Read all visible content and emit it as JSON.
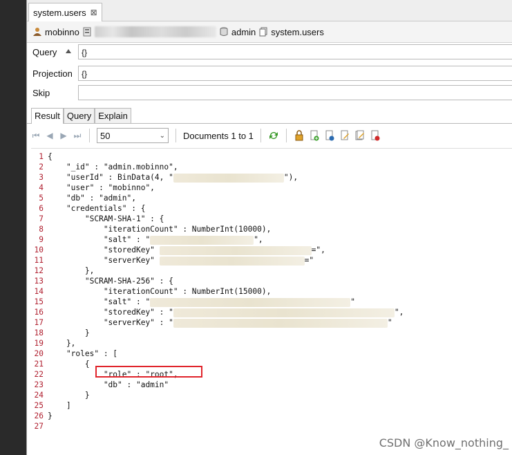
{
  "tab": {
    "title": "system.users",
    "close": "⊠"
  },
  "connection": {
    "user": "mobinno",
    "db": "admin",
    "collection": "system.users"
  },
  "query": {
    "label": "Query",
    "value": "{}"
  },
  "projection": {
    "label": "Projection",
    "value": "{}"
  },
  "skip": {
    "label": "Skip",
    "value": ""
  },
  "result_tabs": [
    "Result",
    "Query",
    "Explain"
  ],
  "toolbar": {
    "page_size": "50",
    "documents_label": "Documents 1 to 1"
  },
  "code_lines": [
    {
      "n": "1",
      "t": "{"
    },
    {
      "n": "2",
      "t": "    \"_id\" : \"admin.mobinno\","
    },
    {
      "n": "3",
      "t": "    \"userId\" : BinData(4, \""
    },
    {
      "n": "4",
      "t": "    \"user\" : \"mobinno\","
    },
    {
      "n": "5",
      "t": "    \"db\" : \"admin\","
    },
    {
      "n": "6",
      "t": "    \"credentials\" : {"
    },
    {
      "n": "7",
      "t": "        \"SCRAM-SHA-1\" : {"
    },
    {
      "n": "8",
      "t": "            \"iterationCount\" : NumberInt(10000),"
    },
    {
      "n": "9",
      "t": "            \"salt\" : \""
    },
    {
      "n": "10",
      "t": "            \"storedKey\" "
    },
    {
      "n": "11",
      "t": "            \"serverKey\" "
    },
    {
      "n": "12",
      "t": "        },"
    },
    {
      "n": "13",
      "t": "        \"SCRAM-SHA-256\" : {"
    },
    {
      "n": "14",
      "t": "            \"iterationCount\" : NumberInt(15000),"
    },
    {
      "n": "15",
      "t": "            \"salt\" : \""
    },
    {
      "n": "16",
      "t": "            \"storedKey\" : \""
    },
    {
      "n": "17",
      "t": "            \"serverKey\" : \""
    },
    {
      "n": "18",
      "t": "        }"
    },
    {
      "n": "19",
      "t": "    },"
    },
    {
      "n": "20",
      "t": "    \"roles\" : ["
    },
    {
      "n": "21",
      "t": "        {"
    },
    {
      "n": "22",
      "t": "            \"role\" : \"root\","
    },
    {
      "n": "23",
      "t": "            \"db\" : \"admin\""
    },
    {
      "n": "24",
      "t": "        }"
    },
    {
      "n": "25",
      "t": "    ]"
    },
    {
      "n": "26",
      "t": "}"
    },
    {
      "n": "27",
      "t": ""
    }
  ],
  "tails": {
    "3": "\"),",
    "9": "\",",
    "10": "=\",",
    "11": "=\"",
    "15": "\"",
    "16": "\",",
    "17": "\""
  },
  "watermark": "CSDN @Know_nothing_"
}
